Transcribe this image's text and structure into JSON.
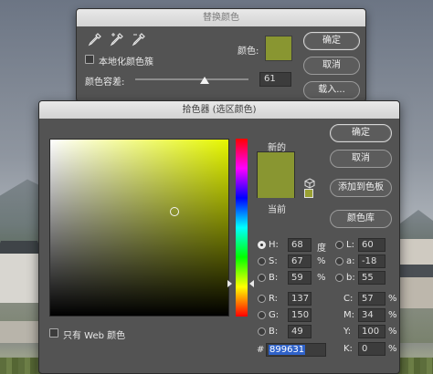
{
  "replace_color": {
    "title": "替换颜色",
    "localized_clusters_label": "本地化颜色簇",
    "color_label": "颜色:",
    "fuzziness_label": "颜色容差:",
    "fuzziness_value": "61",
    "fuzziness_fraction": 0.61,
    "ok_label": "确定",
    "cancel_label": "取消",
    "load_label": "载入...",
    "swatch_color": "#899631",
    "tools": [
      "eyedropper-icon",
      "eyedropper-add-icon",
      "eyedropper-subtract-icon"
    ]
  },
  "color_picker": {
    "title": "拾色器 (选区颜色)",
    "new_label": "新的",
    "current_label": "当前",
    "new_color": "#899631",
    "current_color": "#899631",
    "ok_label": "确定",
    "cancel_label": "取消",
    "add_swatches_label": "添加到色板",
    "color_libraries_label": "颜色库",
    "web_only_label": "只有 Web 颜色",
    "hsb": {
      "h_label": "H:",
      "h_value": "68",
      "h_unit": "度",
      "s_label": "S:",
      "s_value": "67",
      "s_unit": "%",
      "b_label": "B:",
      "b_value": "59",
      "b_unit": "%"
    },
    "rgb": {
      "r_label": "R:",
      "r_value": "137",
      "g_label": "G:",
      "g_value": "150",
      "b_label": "B:",
      "b_value": "49"
    },
    "lab": {
      "l_label": "L:",
      "l_value": "60",
      "a_label": "a:",
      "a_value": "-18",
      "b_label": "b:",
      "b_value": "55"
    },
    "cmyk": {
      "c_label": "C:",
      "c_value": "57",
      "c_unit": "%",
      "m_label": "M:",
      "m_value": "34",
      "m_unit": "%",
      "y_label": "Y:",
      "y_value": "100",
      "y_unit": "%",
      "k_label": "K:",
      "k_value": "0",
      "k_unit": "%"
    },
    "hex_prefix": "#",
    "hex_value": "899631",
    "selected_mode": "H"
  }
}
